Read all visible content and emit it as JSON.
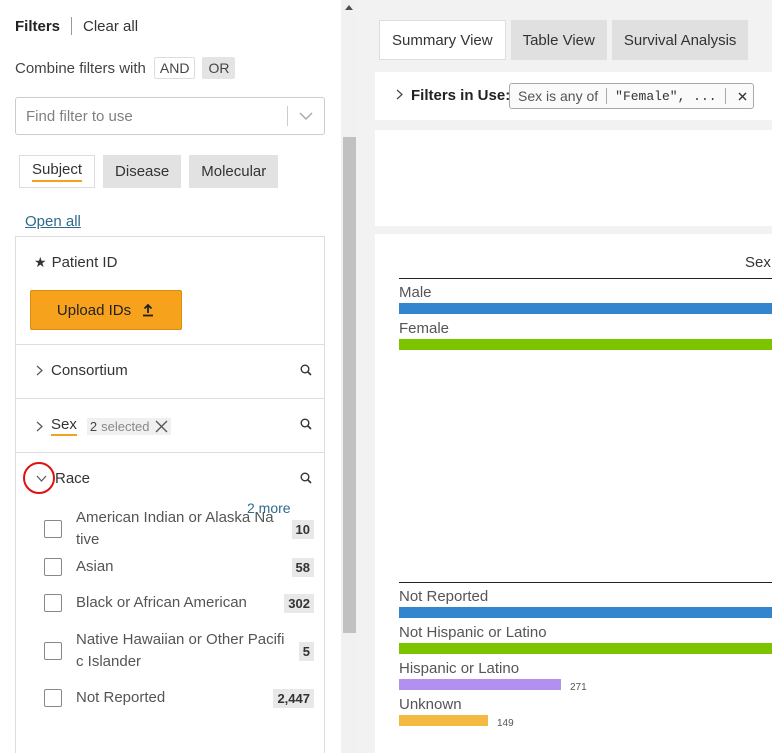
{
  "left": {
    "header": {
      "filters": "Filters",
      "clear_all": "Clear all"
    },
    "combine": {
      "label": "Combine filters with",
      "and": "AND",
      "or": "OR"
    },
    "find_filter": {
      "placeholder": "Find filter to use"
    },
    "tabs": [
      "Subject",
      "Disease",
      "Molecular"
    ],
    "open_all": "Open all",
    "patient_id": {
      "title": "Patient ID",
      "upload": "Upload IDs"
    },
    "facets": {
      "consortium": "Consortium",
      "sex": {
        "label": "Sex",
        "count": "2",
        "selected": "selected"
      },
      "race": {
        "label": "Race"
      }
    },
    "race_options": [
      {
        "label": "American Indian or Alaska Na tive",
        "count": "10"
      },
      {
        "label": "Asian",
        "count": "58"
      },
      {
        "label": "Black or African American",
        "count": "302"
      },
      {
        "label": "Native Hawaiian or Other Pacifi c Islander",
        "count": "5"
      },
      {
        "label": "Not Reported",
        "count": "2,447"
      }
    ],
    "more": "2 more"
  },
  "right": {
    "tabs": [
      "Summary View",
      "Table View",
      "Survival Analysis"
    ],
    "filters_in_use": {
      "label": "Filters in Use:",
      "chip_field": "Sex is any of",
      "chip_value": "\"Female\", ..."
    },
    "chart_title": "Sex"
  },
  "colors": {
    "accent": "#f7a21c",
    "blue": "#3385cd",
    "green": "#7cc300",
    "purple": "#b38ff0",
    "gold": "#f4b942"
  },
  "chart_data": [
    {
      "type": "bar",
      "title": "Sex",
      "categories": [
        "Male",
        "Female"
      ],
      "values": [
        null,
        null
      ],
      "colors": [
        "#3385cd",
        "#7cc300"
      ]
    },
    {
      "type": "bar",
      "title": "",
      "categories": [
        "Not Reported",
        "Not Hispanic or Latino",
        "Hispanic or Latino",
        "Unknown"
      ],
      "values": [
        null,
        null,
        271,
        149
      ],
      "colors": [
        "#3385cd",
        "#7cc300",
        "#b38ff0",
        "#f4b942"
      ]
    }
  ]
}
